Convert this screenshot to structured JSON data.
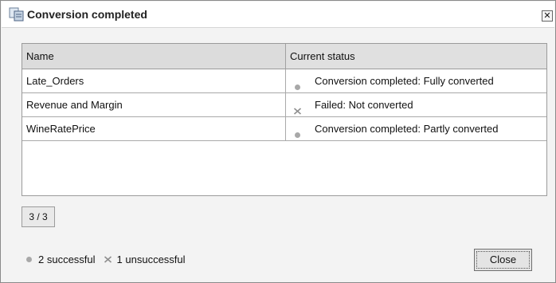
{
  "window": {
    "title": "Conversion completed",
    "close_glyph": "✕"
  },
  "table": {
    "headers": [
      "Name",
      "Current status"
    ],
    "rows": [
      {
        "name": "Late_Orders",
        "status_icon": "success-dot-icon",
        "status": "Conversion completed: Fully converted"
      },
      {
        "name": "Revenue and Margin",
        "status_icon": "fail-x-icon",
        "status": "Failed: Not converted"
      },
      {
        "name": "WineRatePrice",
        "status_icon": "success-dot-icon",
        "status": "Conversion completed: Partly converted"
      }
    ]
  },
  "page_indicator": "3 / 3",
  "summary": {
    "successful": "2 successful",
    "unsuccessful": "1 unsuccessful"
  },
  "buttons": {
    "close": "Close"
  },
  "colors": {
    "success_dot": "#a8a8a8",
    "fail_x": "#9a9a9a"
  }
}
